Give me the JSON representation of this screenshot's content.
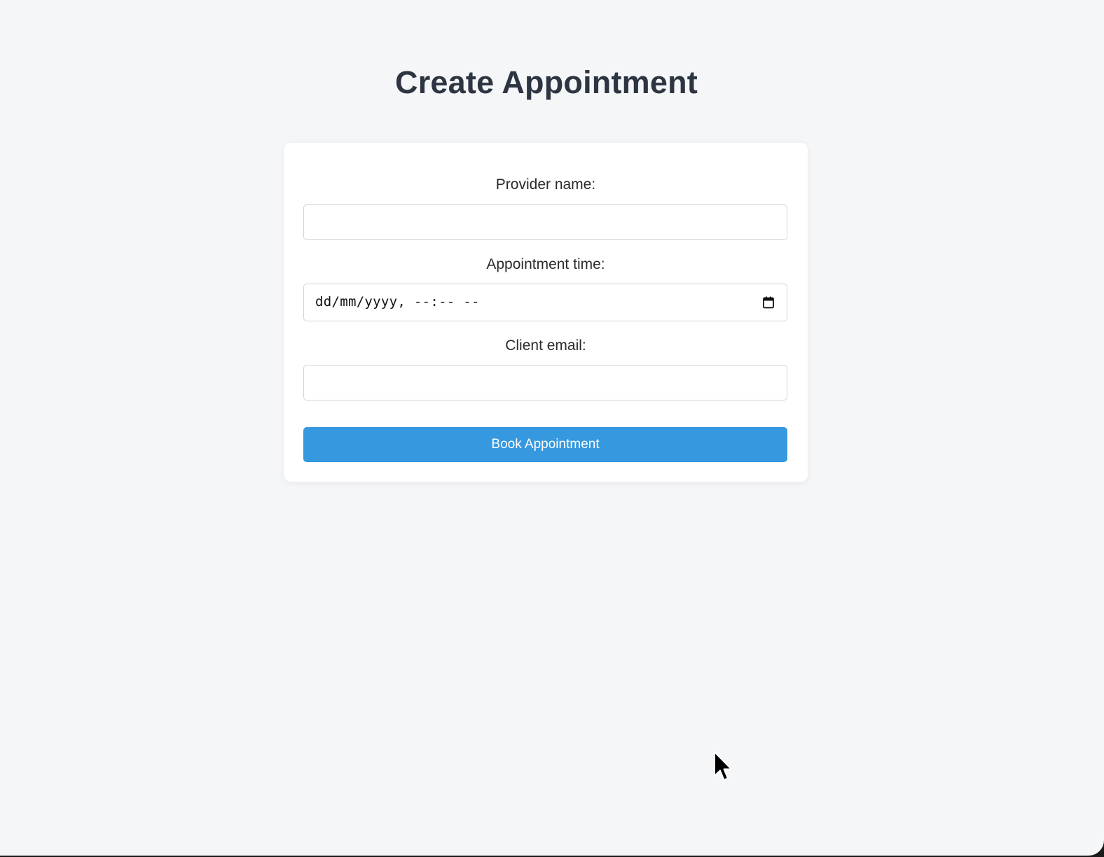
{
  "page": {
    "title": "Create Appointment"
  },
  "form": {
    "provider_label": "Provider name:",
    "provider_value": "",
    "time_label": "Appointment time:",
    "time_placeholder": "dd/mm/yyyy, --:-- --",
    "email_label": "Client email:",
    "email_value": "",
    "submit_label": "Book Appointment"
  },
  "colors": {
    "background": "#f5f6f8",
    "card": "#ffffff",
    "title": "#2e3542",
    "button": "#3698de",
    "button_text": "#ffffff",
    "input_border": "#d0d3d8"
  },
  "icons": {
    "date_picker": "calendar-icon",
    "pointer": "cursor-icon"
  }
}
